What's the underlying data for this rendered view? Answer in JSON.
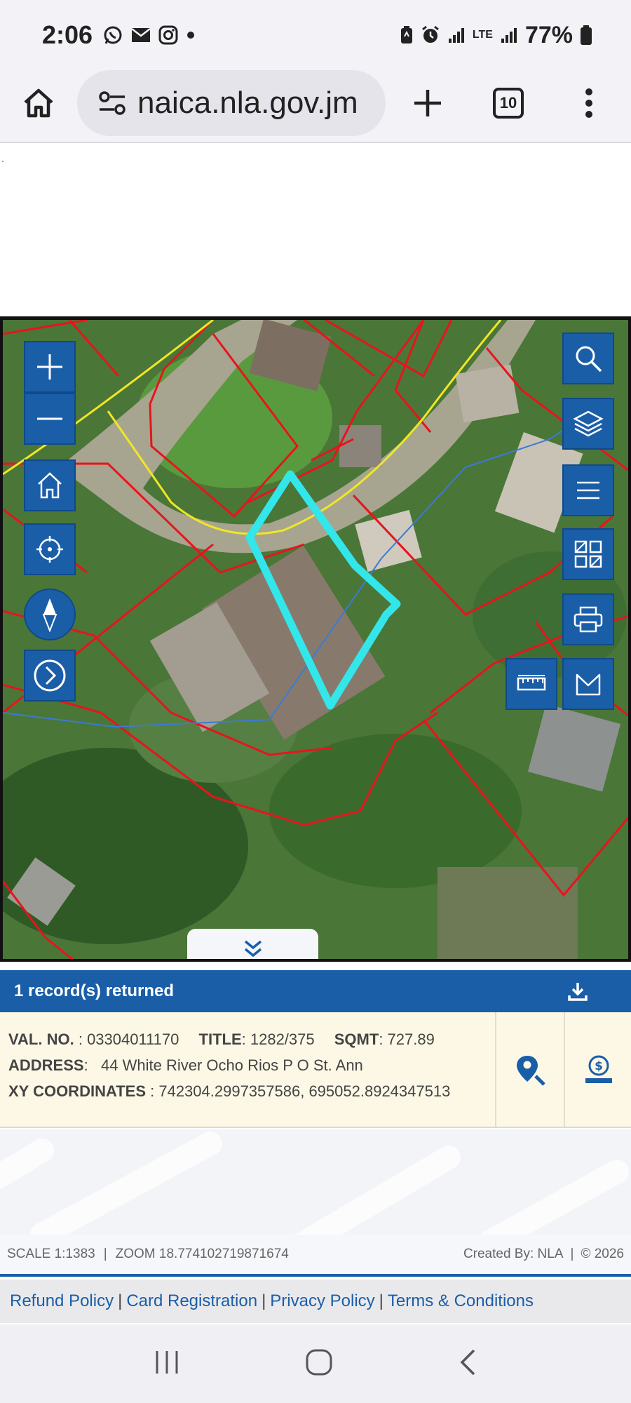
{
  "status_bar": {
    "time": "2:06",
    "battery": "77%",
    "network": "LTE",
    "left_icons": [
      "whatsapp-icon",
      "mail-icon",
      "instagram-icon",
      "dot-icon"
    ],
    "right_icons": [
      "battery-saver-icon",
      "alarm-icon",
      "signal-icon",
      "lte-icon",
      "signal-icon",
      "battery-icon"
    ]
  },
  "browser": {
    "url": "naica.nla.gov.jm",
    "tab_count": "10"
  },
  "page": {
    "stray_mark": "."
  },
  "map": {
    "parcel_highlight_color": "#33e6ea",
    "boundary_color": "#e8141c",
    "road_color": "#f2e623",
    "stream_color": "#3a7bd5",
    "tools": [
      "zoom-in",
      "zoom-out",
      "home",
      "locate",
      "compass",
      "next",
      "search",
      "layers",
      "menu",
      "basemap-gallery",
      "print",
      "measure",
      "draw"
    ]
  },
  "results": {
    "header": "1 record(s) returned",
    "record": {
      "val_no_label": "VAL. NO.",
      "val_no": "03304011170",
      "title_label": "TITLE",
      "title": "1282/375",
      "sqmt_label": "SQMT",
      "sqmt": "727.89",
      "address_label": "ADDRESS",
      "address": "44 White River Ocho Rios P O St. Ann",
      "xy_label": "XY COORDINATES",
      "xy": "742304.2997357586, 695052.8924347513"
    }
  },
  "scale_bar": {
    "scale": "SCALE 1:1383",
    "zoom": "ZOOM 18.774102719871674",
    "created_by": "Created By: NLA",
    "copyright": "© 2026"
  },
  "footer": {
    "links": [
      "Refund Policy",
      "Card Registration",
      "Privacy Policy",
      "Terms & Conditions"
    ],
    "separator": "|"
  },
  "colors": {
    "brand_blue": "#1a5ea8",
    "record_bg": "#fdf8e6"
  }
}
